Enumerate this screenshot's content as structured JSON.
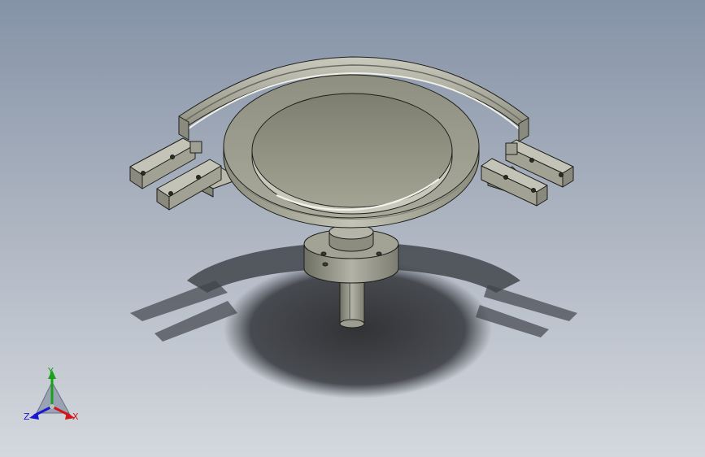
{
  "viewport": {
    "background_top": "#8593a7",
    "background_bottom": "#d4d8de"
  },
  "triad": {
    "y_label": "Y",
    "x_label": "X",
    "z_label": "Z",
    "y_color": "#1aa01a",
    "x_color": "#d01818",
    "z_color": "#1818d0"
  },
  "model": {
    "part_color": "#a7a899",
    "edge_color": "#1f1f1a"
  }
}
